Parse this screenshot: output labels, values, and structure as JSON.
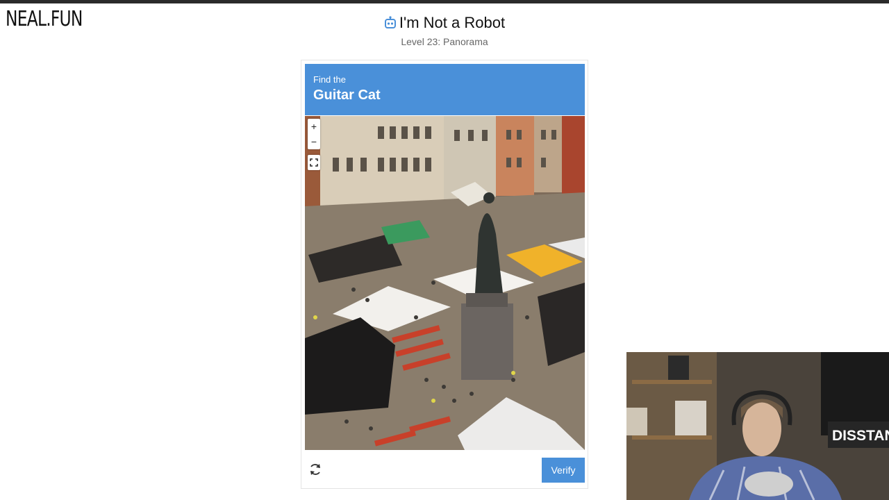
{
  "site": {
    "logo": "NEAL.FUN"
  },
  "header": {
    "title": "I'm Not a Robot",
    "level": "Level 23: Panorama",
    "icon": "robot-icon"
  },
  "captcha": {
    "prompt": "Find the",
    "target": "Guitar Cat",
    "zoom_in_label": "+",
    "zoom_out_label": "−",
    "verify_label": "Verify",
    "accent_color": "#4a90d9"
  },
  "webcam": {
    "sign_text": "DISSTANS"
  }
}
